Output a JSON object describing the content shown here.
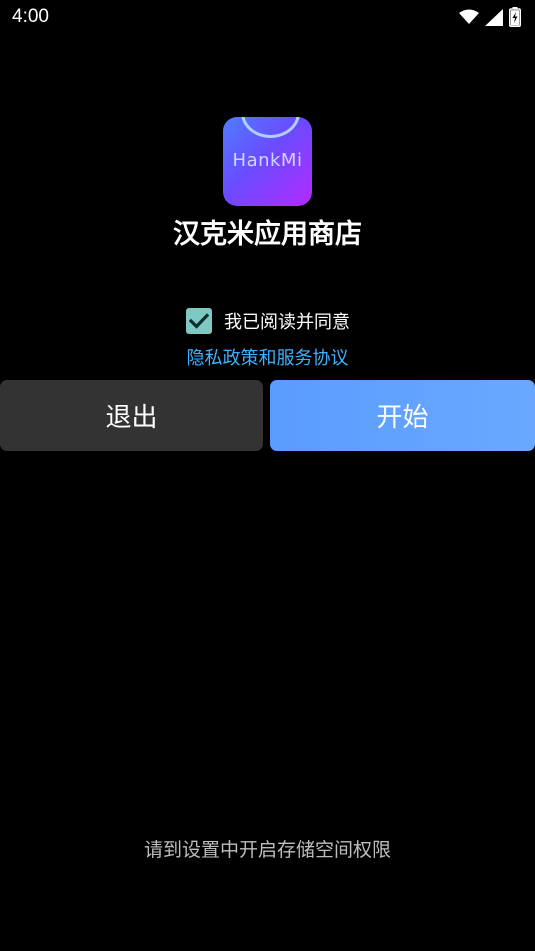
{
  "status_bar": {
    "time": "4:00",
    "icons": [
      "wifi-icon",
      "cellular-signal-icon",
      "battery-charging-icon"
    ]
  },
  "app": {
    "icon_text": "HankMi",
    "name": "汉克米应用商店"
  },
  "agreement": {
    "checked": true,
    "label": "我已阅读并同意",
    "link_text": "隐私政策和服务协议"
  },
  "buttons": {
    "exit_label": "退出",
    "start_label": "开始"
  },
  "hint": {
    "text": "请到设置中开启存储空间权限"
  },
  "colors": {
    "background": "#000000",
    "checkbox": "#7ec9c3",
    "link": "#3db2ff",
    "start_button": "#5a9cff",
    "exit_button": "#333333"
  }
}
